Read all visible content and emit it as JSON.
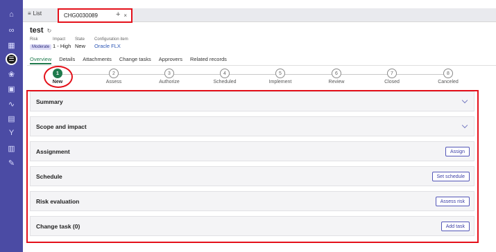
{
  "rail": {
    "items": [
      {
        "name": "home-icon",
        "glyph": "⌂"
      },
      {
        "name": "link-icon",
        "glyph": "∞"
      },
      {
        "name": "calendar-icon",
        "glyph": "▦"
      },
      {
        "name": "list-icon",
        "glyph": "☰"
      },
      {
        "name": "group-icon",
        "glyph": "❀"
      },
      {
        "name": "grid-icon",
        "glyph": "▣"
      },
      {
        "name": "activity-icon",
        "glyph": "∿"
      },
      {
        "name": "book-icon",
        "glyph": "▤"
      },
      {
        "name": "flow-icon",
        "glyph": "Y"
      },
      {
        "name": "chart-icon",
        "glyph": "▥"
      },
      {
        "name": "tag-icon",
        "glyph": "✎"
      }
    ]
  },
  "tabs": {
    "list_label": "List",
    "active_label": "CHG0030089",
    "close_glyph": "×",
    "add_glyph": "+"
  },
  "record": {
    "title": "test",
    "refresh_glyph": "↻",
    "fields": [
      {
        "label": "Risk",
        "value": "Moderate"
      },
      {
        "label": "Impact",
        "value": "1 - High"
      },
      {
        "label": "State",
        "value": "New"
      },
      {
        "label": "Configuration item",
        "value": "Oracle FLX"
      }
    ]
  },
  "record_tabs": [
    "Overview",
    "Details",
    "Attachments",
    "Change tasks",
    "Approvers",
    "Related records"
  ],
  "steps": [
    {
      "num": "1",
      "label": "New"
    },
    {
      "num": "2",
      "label": "Assess"
    },
    {
      "num": "3",
      "label": "Authorize"
    },
    {
      "num": "4",
      "label": "Scheduled"
    },
    {
      "num": "5",
      "label": "Implement"
    },
    {
      "num": "6",
      "label": "Review"
    },
    {
      "num": "7",
      "label": "Closed"
    },
    {
      "num": "8",
      "label": "Canceled"
    }
  ],
  "sections": [
    {
      "title": "Summary"
    },
    {
      "title": "Scope and impact"
    },
    {
      "title": "Assignment",
      "button": "Assign"
    },
    {
      "title": "Schedule",
      "button": "Set schedule"
    },
    {
      "title": "Risk evaluation",
      "button": "Assess risk"
    },
    {
      "title": "Change task (0)",
      "button": "Add task"
    }
  ],
  "colors": {
    "rail": "#4b4ba4",
    "accent_green": "#1f7a4d",
    "highlight_red": "#e4101a",
    "button_blue": "#3b3ea6"
  }
}
